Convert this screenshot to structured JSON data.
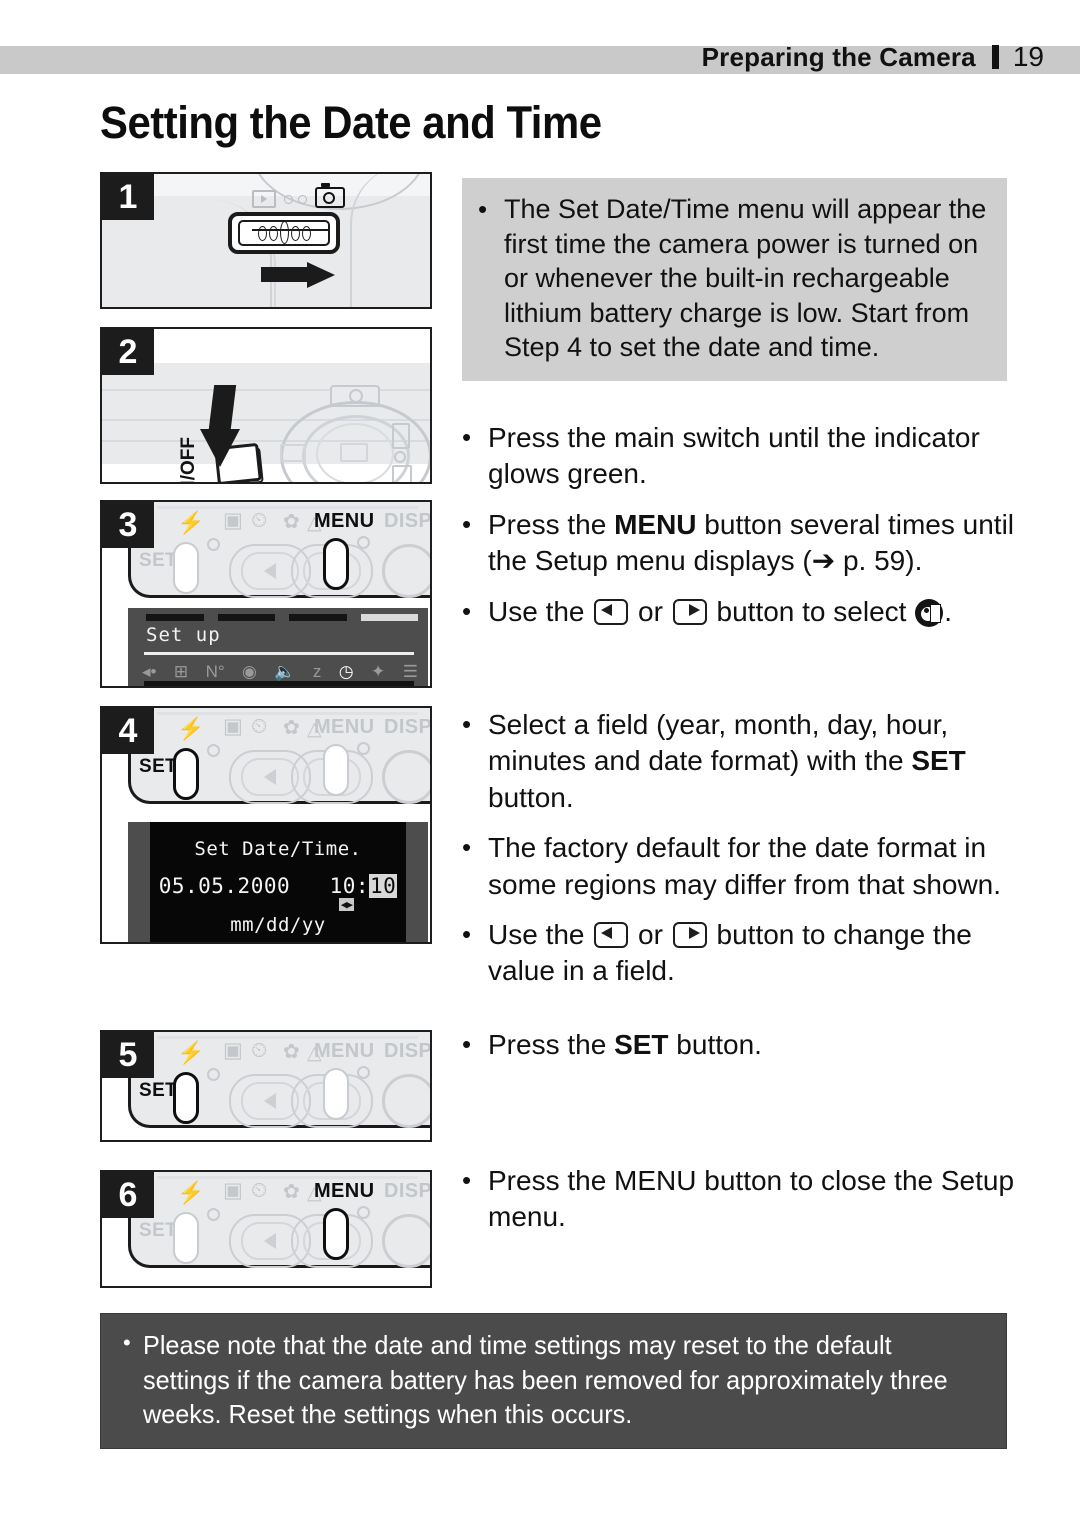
{
  "header": {
    "section_title": "Preparing the Camera",
    "page_number": "19"
  },
  "page_title": "Setting the Date and Time",
  "note_box": {
    "bullet": "•",
    "text": "The Set Date/Time menu will appear the first time the camera power is turned on or whenever the built-in rechargeable lithium battery charge is low. Start from Step 4 to set the date and time."
  },
  "instructions": [
    {
      "bullet": "•",
      "parts": [
        {
          "text": "Press the main switch until the indicator glows green."
        }
      ]
    },
    {
      "bullet": "•",
      "parts": [
        {
          "text": "Press the "
        },
        {
          "text": "MENU",
          "bold": true
        },
        {
          "text": " button several times until the Setup menu displays (➔ p. 59)."
        }
      ]
    },
    {
      "bullet": "•",
      "parts": [
        {
          "text": "Use  the "
        },
        {
          "icon": "left-button-icon"
        },
        {
          "text": " or "
        },
        {
          "icon": "right-button-icon"
        },
        {
          "text": " button to select "
        },
        {
          "icon": "date-time-icon"
        },
        {
          "text": "."
        }
      ]
    },
    {
      "bullet": "•",
      "parts": [
        {
          "text": "Select a field (year, month, day, hour, minutes and date format) with the "
        },
        {
          "text": "SET",
          "bold": true
        },
        {
          "text": " button."
        }
      ]
    },
    {
      "bullet": "•",
      "parts": [
        {
          "text": "The factory default for the date format in some regions may differ from that shown."
        }
      ]
    },
    {
      "bullet": "•",
      "parts": [
        {
          "text": "Use the "
        },
        {
          "icon": "left-button-icon"
        },
        {
          "text": " or "
        },
        {
          "icon": "right-button-icon"
        },
        {
          "text": " button to change the value in a field."
        }
      ]
    },
    {
      "bullet": "•",
      "parts": [
        {
          "text": "Press the "
        },
        {
          "text": "SET",
          "bold": true
        },
        {
          "text": " button."
        }
      ]
    },
    {
      "bullet": "•",
      "parts": [
        {
          "text": "Press the MENU button to close the Setup menu."
        }
      ]
    }
  ],
  "steps": [
    {
      "number": "1",
      "caption": "camera-mode-switch-illustration"
    },
    {
      "number": "2",
      "caption": "on-off-button-illustration"
    },
    {
      "number": "3",
      "caption": "menu-button-and-setup-screen-illustration"
    },
    {
      "number": "4",
      "caption": "set-button-and-date-time-screen-illustration"
    },
    {
      "number": "5",
      "caption": "set-button-illustration"
    },
    {
      "number": "6",
      "caption": "menu-button-illustration"
    }
  ],
  "camera_buttons": {
    "set_label": "SET",
    "menu_label": "MENU",
    "disp_label": "DISP",
    "on_off_label": "ON/OFF"
  },
  "lcd_setup": {
    "title": "Set up",
    "icons": [
      "◀",
      "⌗",
      "No.",
      "◉",
      "◁)",
      "z",
      "◷",
      "✧",
      "☰"
    ]
  },
  "lcd_date": {
    "title": "Set Date/Time.",
    "date_value": "05.05.2000",
    "time_hour": "10:",
    "time_minute": "10",
    "arrows": "◀▶",
    "format": "mm/dd/yy"
  },
  "caution": {
    "bullet": "•",
    "text": "Please note that the date and time settings may reset to the default settings if the camera battery has been removed for approximately three weeks. Reset the settings when this occurs."
  },
  "colors": {
    "header_band": "#c9c9c9",
    "note_box_bg": "#cfcfcf",
    "caution_bg": "#4b4b4b",
    "badge_bg": "#1c1c1c",
    "lcd_bg": "#4d4d4d",
    "lcd_screen": "#070707",
    "camera_body": "#e8eaec"
  }
}
